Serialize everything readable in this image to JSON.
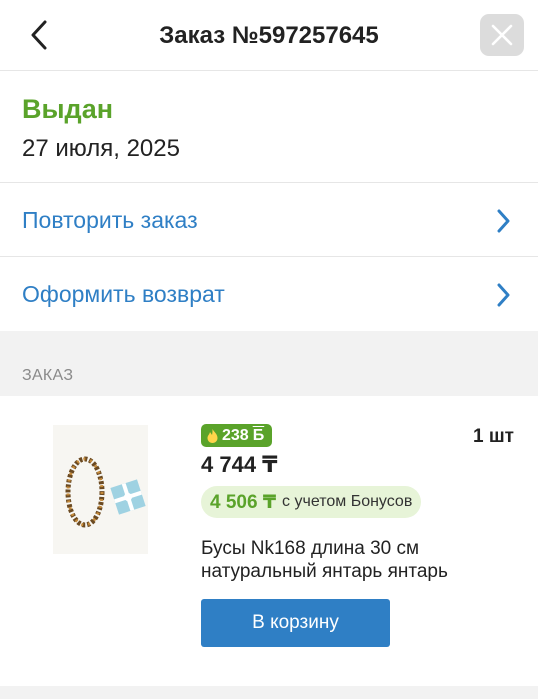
{
  "header": {
    "title": "Заказ №597257645"
  },
  "status": {
    "label": "Выдан",
    "date": "27 июля, 2025"
  },
  "actions": {
    "repeat_label": "Повторить заказ",
    "return_label": "Оформить возврат"
  },
  "section": {
    "title": "ЗАКАЗ"
  },
  "item": {
    "bonus_badge": "238",
    "bonus_currency": "Б",
    "quantity": "1 шт",
    "price": "4 744 ₸",
    "bonus_price": "4 506 ₸",
    "bonus_note": "с учетом Бонусов",
    "name": "Бусы Nk168 длина 30 см натуральный янтарь янтарь",
    "cart_label": "В корзину"
  },
  "colors": {
    "accent_blue": "#2f7fc5",
    "status_green": "#5aa32a",
    "bonus_bg": "#e7f4d8"
  }
}
